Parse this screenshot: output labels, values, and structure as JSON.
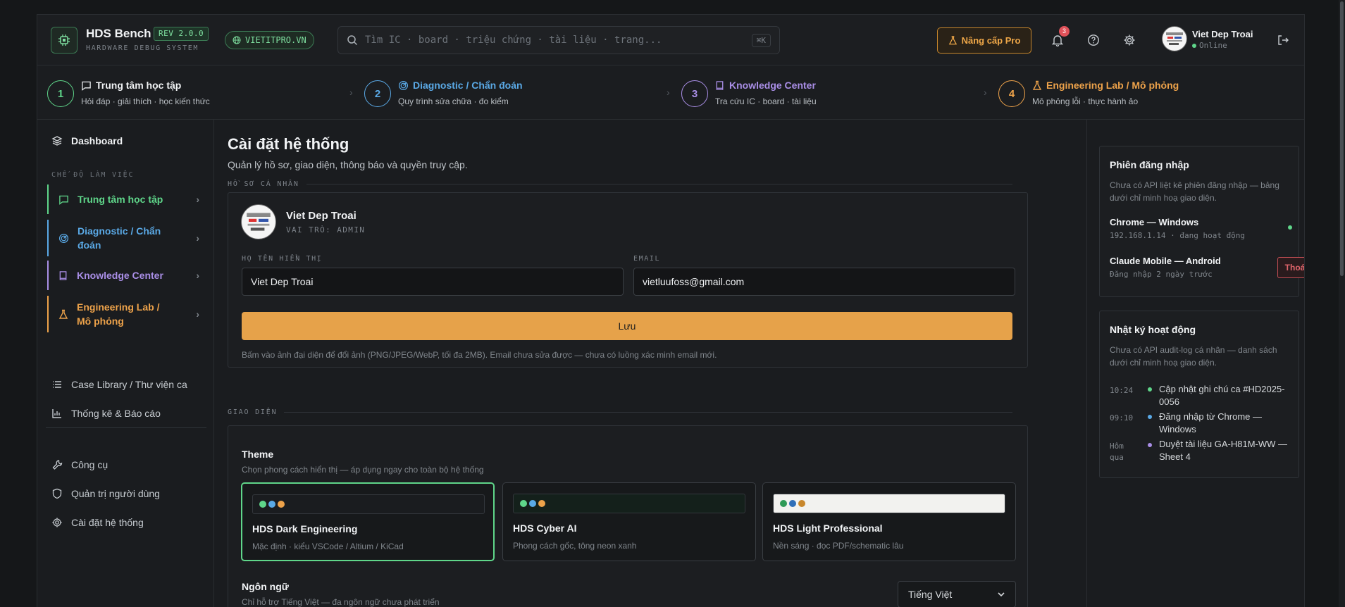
{
  "header": {
    "brand_title": "HDS Bench",
    "version": "REV 2.0.0",
    "brand_subtitle": "HARDWARE DEBUG SYSTEM",
    "site": "VIETITPRO.VN",
    "search_placeholder": "Tìm IC · board · triệu chứng · tài liệu · trang...",
    "search_shortcut": "⌘K",
    "upgrade_label": "Nâng cấp Pro",
    "notification_count": "3",
    "user_name": "Viet Dep Troai",
    "user_status": "Online"
  },
  "steps": [
    {
      "num": "1",
      "title": "Trung tâm học tập",
      "subtitle": "Hỏi đáp · giải thích · học kiến thức",
      "color": "#5fd68a"
    },
    {
      "num": "2",
      "title": "Diagnostic / Chẩn đoán",
      "subtitle": "Quy trình sửa chữa · đo kiểm",
      "color": "#5aa9e6"
    },
    {
      "num": "3",
      "title": "Knowledge Center",
      "subtitle": "Tra cứu IC · board · tài liệu",
      "color": "#a98ee6"
    },
    {
      "num": "4",
      "title": "Engineering Lab / Mô phỏng",
      "subtitle": "Mô phỏng lỗi · thực hành ảo",
      "color": "#eda24a"
    }
  ],
  "sidebar": {
    "dashboard": "Dashboard",
    "section_label": "CHẾ ĐỘ LÀM VIỆC",
    "modes": [
      {
        "label": "Trung tâm học tập",
        "color": "#5fd68a"
      },
      {
        "label": "Diagnostic / Chẩn đoán",
        "color": "#5aa9e6"
      },
      {
        "label": "Knowledge Center",
        "color": "#a98ee6"
      },
      {
        "label": "Engineering Lab / Mô phỏng",
        "color": "#eda24a"
      }
    ],
    "case_library": "Case Library / Thư viện ca",
    "reports": "Thống kê & Báo cáo",
    "tools": "Công cụ",
    "user_admin": "Quản trị người dùng",
    "settings": "Cài đặt hệ thống"
  },
  "main": {
    "title": "Cài đặt hệ thống",
    "subtitle": "Quản lý hồ sơ, giao diện, thông báo và quyền truy cập.",
    "profile_section": "HỒ SƠ CÁ NHÂN",
    "profile": {
      "name": "Viet Dep Troai",
      "role": "VAI TRÒ: ADMIN",
      "display_name_label": "HỌ TÊN HIỂN THỊ",
      "display_name_value": "Viet Dep Troai",
      "email_label": "EMAIL",
      "email_value": "vietluufoss@gmail.com",
      "save_label": "Lưu",
      "hint": "Bấm vào ảnh đại diện để đổi ảnh (PNG/JPEG/WebP, tối đa 2MB). Email chưa sửa được — chưa có luồng xác minh email mới."
    },
    "appearance_section": "GIAO DIỆN",
    "theme": {
      "title": "Theme",
      "subtitle": "Chọn phong cách hiển thị — áp dụng ngay cho toàn bộ hệ thống",
      "options": [
        {
          "name": "HDS Dark Engineering",
          "desc": "Mặc định · kiểu VSCode / Altium / KiCad",
          "selected": true
        },
        {
          "name": "HDS Cyber AI",
          "desc": "Phong cách gốc, tông neon xanh",
          "selected": false
        },
        {
          "name": "HDS Light Professional",
          "desc": "Nền sáng · đọc PDF/schematic lâu",
          "selected": false
        }
      ]
    },
    "language": {
      "title": "Ngôn ngữ",
      "subtitle": "Chỉ hỗ trợ Tiếng Việt — đa ngôn ngữ chưa phát triển",
      "selected": "Tiếng Việt"
    }
  },
  "sessions": {
    "title": "Phiên đăng nhập",
    "note": "Chưa có API liệt kê phiên đăng nhập — bảng dưới chỉ minh hoạ giao diện.",
    "items": [
      {
        "name": "Chrome — Windows",
        "meta": "192.168.1.14 · đang hoạt động"
      },
      {
        "name": "Claude Mobile — Android",
        "meta": "Đăng nhập 2 ngày trước"
      }
    ],
    "logout_label": "Thoát"
  },
  "activity": {
    "title": "Nhật ký hoạt động",
    "note": "Chưa có API audit-log cá nhân — danh sách dưới chỉ minh hoạ giao diện.",
    "items": [
      {
        "time": "10:24",
        "text": "Cập nhật ghi chú ca #HD2025-0056",
        "color": "#5fd68a"
      },
      {
        "time": "09:10",
        "text": "Đăng nhập từ Chrome — Windows",
        "color": "#5aa9e6"
      },
      {
        "time": "Hôm qua",
        "text": "Duyệt tài liệu GA-H81M-WW — Sheet 4",
        "color": "#a98ee6"
      }
    ]
  }
}
